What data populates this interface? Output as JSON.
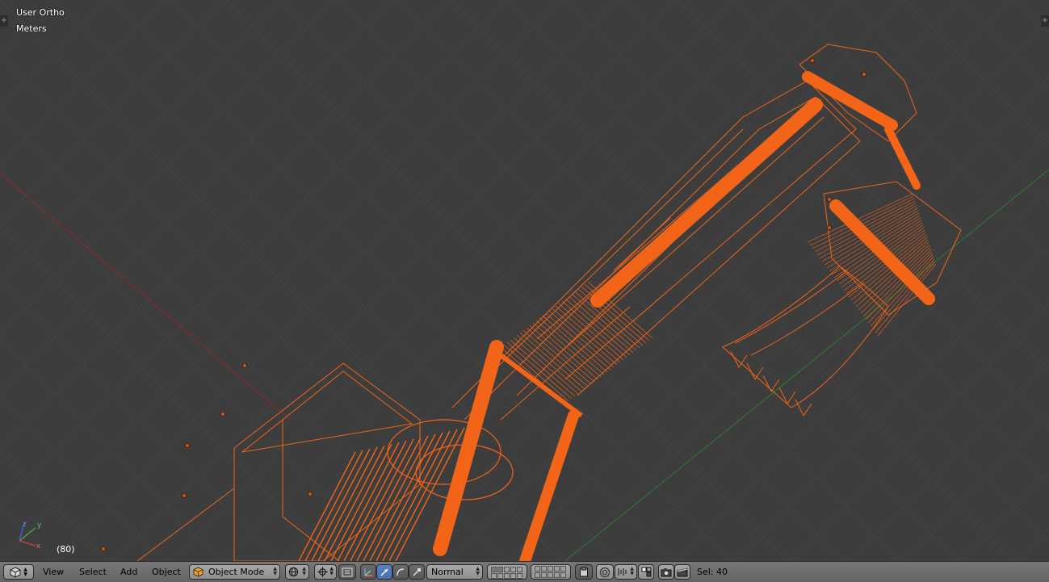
{
  "viewport": {
    "view_name": "User Ortho",
    "units": "Meters",
    "frame": "(80)",
    "background_color": "#3d3d3d",
    "selection_color": "#f26418",
    "axis_x_color": "#8c2a2a",
    "axis_y_color": "#2f7a2f",
    "gizmo": {
      "x_label": "x",
      "y_label": "y",
      "z_label": "z"
    }
  },
  "header": {
    "editor_type_icon": "cube-icon",
    "menus": [
      "View",
      "Select",
      "Add",
      "Object"
    ],
    "mode_select": {
      "value": "Object Mode",
      "icon": "object-cube-icon"
    },
    "viewport_shading_icon": "sphere-shading-icon",
    "pivot_icon": "crosshair-icon",
    "manipulator_icons": [
      "axis-manipulator-icon",
      "translate-icon",
      "rotate-icon",
      "scale-icon"
    ],
    "transform_orientation": {
      "value": "Normal"
    },
    "layers": {
      "count": 20
    },
    "selection_status": "Sel: 40"
  }
}
